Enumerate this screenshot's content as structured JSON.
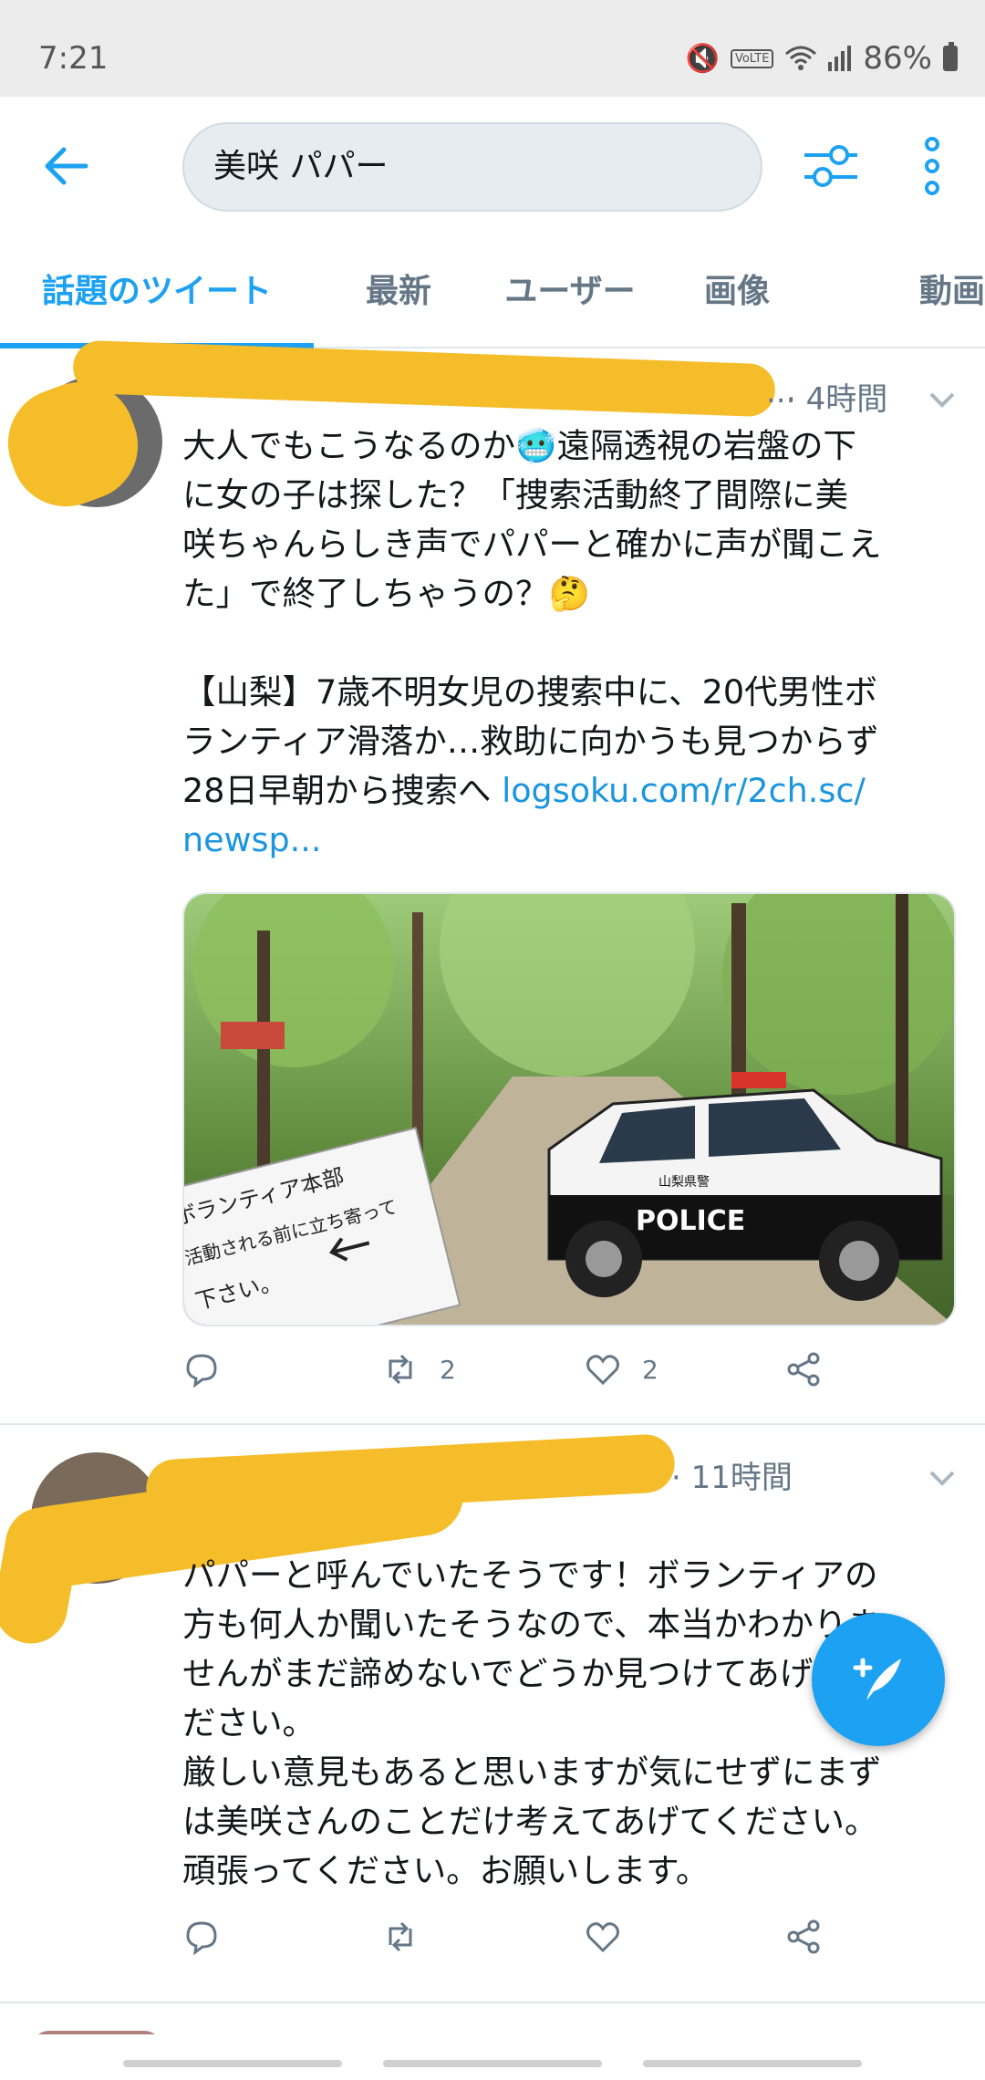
{
  "status_bar": {
    "time": "7:21",
    "battery": "86%"
  },
  "search": {
    "query": "美咲 パパー"
  },
  "tabs": [
    {
      "label": "話題のツイート",
      "active": true
    },
    {
      "label": "最新"
    },
    {
      "label": "ユーザー"
    },
    {
      "label": "画像"
    },
    {
      "label": "動画"
    }
  ],
  "tweets": [
    {
      "handle_visible": "...",
      "time": "· 4時間",
      "text_lines": [
        "大人でもこうなるのか🥶遠隔透視の岩盤の下",
        "に女の子は探した？「捜索活動終了間際に美",
        "咲ちゃんらしき声でパパーと確かに声が聞こえ",
        "た」で終了しちゃうの？🤔",
        "",
        "【山梨】7歳不明女児の捜索中に、20代男性ボ",
        "ランティア滑落か…救助に向かうも見つからず",
        "28日早朝から捜索へ "
      ],
      "link_text_1": "logsoku.com/r/2ch.sc/",
      "link_text_2": "newsp...",
      "image": {
        "sign_text_1": "ボランティア本部",
        "sign_text_2": "活動される前に立ち寄って",
        "sign_text_3": "下さい。",
        "police_text": "POLICE",
        "car_text": "山梨県警"
      },
      "retweets": "2",
      "likes": "2"
    },
    {
      "handle_visible": "",
      "time": "· 11時間",
      "text_lines": [
        "パパーと呼んでいたそうです！ボランティアの",
        "方も何人か聞いたそうなので、本当かわかりま",
        "せんがまだ諦めないでどうか見つけてあげてく",
        "ださい。",
        "厳しい意見もあると思いますが気にせずにまず",
        "は美咲さんのことだけ考えてあげてください。",
        "頑張ってください。お願いします。"
      ],
      "retweets": "",
      "likes": ""
    }
  ],
  "colors": {
    "accent": "#1da1f2",
    "muted": "#657786",
    "redaction": "#f5bd2a"
  }
}
